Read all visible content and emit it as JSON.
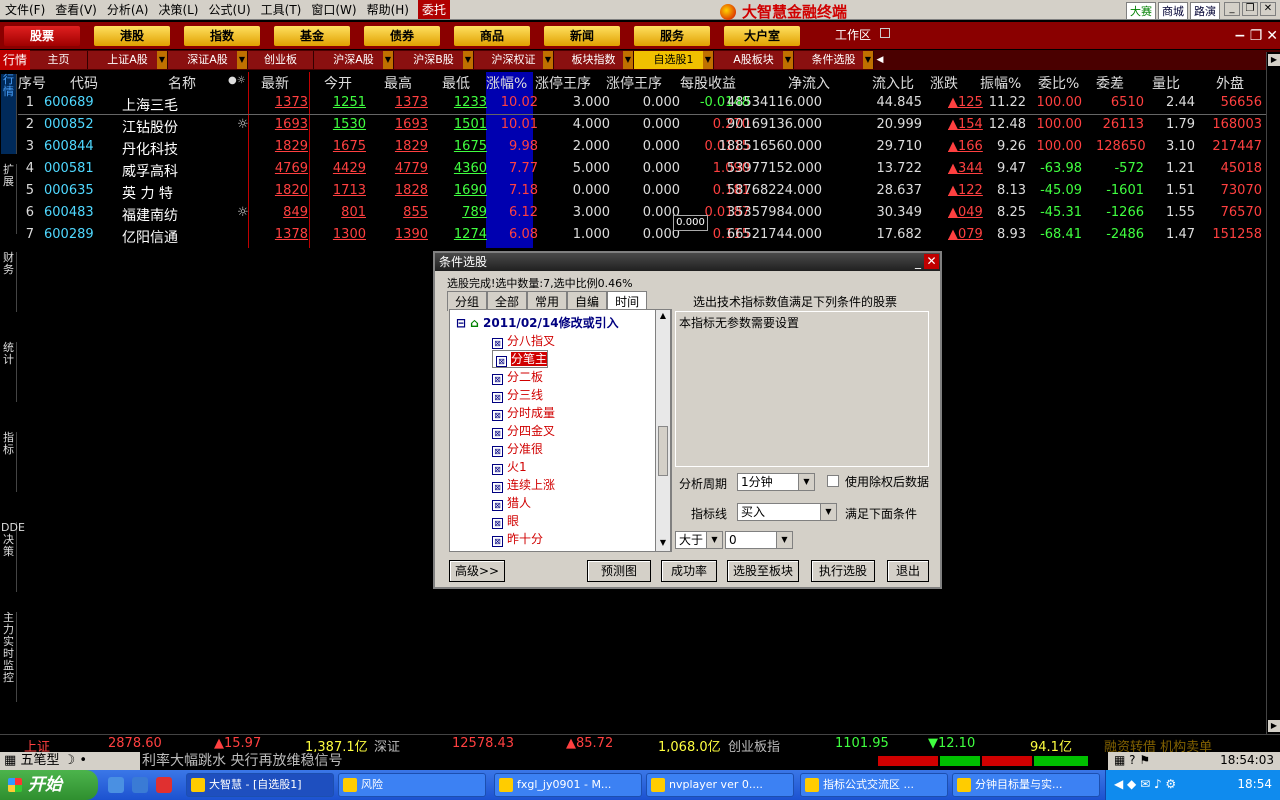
{
  "menu": [
    "文件(F)",
    "查看(V)",
    "分析(A)",
    "决策(L)",
    "公式(U)",
    "工具(T)",
    "窗口(W)",
    "帮助(H)"
  ],
  "weituo": "委托",
  "brand": "大智慧金融终端",
  "right_links": [
    "大赛",
    "商城",
    "路演"
  ],
  "categories": [
    "股票",
    "港股",
    "指数",
    "基金",
    "债券",
    "商品",
    "新闻",
    "服务",
    "大户室"
  ],
  "workzone": "工作区",
  "side_label": "行情",
  "tabs": [
    "主页",
    "上证A股",
    "深证A股",
    "创业板",
    "沪深A股",
    "沪深B股",
    "沪深权证",
    "板块指数",
    "自选股1",
    "A股板块",
    "条件选股"
  ],
  "left_tabs": [
    "行情",
    "扩展",
    "财务",
    "统计",
    "指标",
    "DDE决策",
    "主力实时监控"
  ],
  "columns": [
    "序号",
    "代码",
    "名称",
    "最新",
    "今开",
    "最高",
    "最低",
    "涨幅%",
    "涨停王序",
    "涨停王序",
    "每股收益",
    "净流入",
    "流入比",
    "涨跌",
    "振幅%",
    "委比%",
    "委差",
    "量比",
    "外盘"
  ],
  "rows": [
    {
      "seq": "1",
      "code": "600689",
      "name": "上海三毛",
      "flag": "",
      "last": "1373",
      "open": "1251",
      "high": "1373",
      "low": "1233",
      "chg": "10.02",
      "a": "3.000",
      "b": "0.000",
      "eps": "-0.0148",
      "inflow": "48534116.000",
      "ratio": "44.845",
      "up": "▲125",
      "amp": "11.22",
      "wb": "100.00",
      "wc": "6510",
      "lb": "2.44",
      "wp": "56656"
    },
    {
      "seq": "2",
      "code": "000852",
      "name": "江钻股份",
      "flag": "☼",
      "last": "1693",
      "open": "1530",
      "high": "1693",
      "low": "1501",
      "chg": "10.01",
      "a": "4.000",
      "b": "0.000",
      "eps": "0.270",
      "inflow": "90169136.000",
      "ratio": "20.999",
      "up": "▲154",
      "amp": "12.48",
      "wb": "100.00",
      "wc": "26113",
      "lb": "1.79",
      "wp": "168003"
    },
    {
      "seq": "3",
      "code": "600844",
      "name": "丹化科技",
      "flag": "",
      "last": "1829",
      "open": "1675",
      "high": "1829",
      "low": "1675",
      "chg": "9.98",
      "a": "2.000",
      "b": "0.000",
      "eps": "0.0115",
      "inflow": "188516560.000",
      "ratio": "29.710",
      "up": "▲166",
      "amp": "9.26",
      "wb": "100.00",
      "wc": "128650",
      "lb": "3.10",
      "wp": "217447"
    },
    {
      "seq": "4",
      "code": "000581",
      "name": "威孚高科",
      "flag": "",
      "last": "4769",
      "open": "4429",
      "high": "4779",
      "low": "4360",
      "chg": "7.77",
      "a": "5.000",
      "b": "0.000",
      "eps": "1.090",
      "inflow": "53977152.000",
      "ratio": "13.722",
      "up": "▲344",
      "amp": "9.47",
      "wb": "-63.98",
      "wc": "-572",
      "lb": "1.21",
      "wp": "45018"
    },
    {
      "seq": "5",
      "code": "000635",
      "name": "英 力 特",
      "flag": "",
      "last": "1820",
      "open": "1713",
      "high": "1828",
      "low": "1690",
      "chg": "7.18",
      "a": "0.000",
      "b": "0.000",
      "eps": "0.181",
      "inflow": "58768224.000",
      "ratio": "28.637",
      "up": "▲122",
      "amp": "8.13",
      "wb": "-45.09",
      "wc": "-1601",
      "lb": "1.51",
      "wp": "73070"
    },
    {
      "seq": "6",
      "code": "600483",
      "name": "福建南纺",
      "flag": "☼",
      "last": "849",
      "open": "801",
      "high": "855",
      "low": "789",
      "chg": "6.12",
      "a": "3.000",
      "b": "0.000",
      "eps": "0.0187",
      "inflow": "35357984.000",
      "ratio": "30.349",
      "up": "▲049",
      "amp": "8.25",
      "wb": "-45.31",
      "wc": "-1266",
      "lb": "1.55",
      "wp": "76570"
    },
    {
      "seq": "7",
      "code": "600289",
      "name": "亿阳信通",
      "flag": "",
      "last": "1378",
      "open": "1300",
      "high": "1390",
      "low": "1274",
      "chg": "6.08",
      "a": "1.000",
      "b": "0.000",
      "eps": "0.115",
      "inflow": "66521744.000",
      "ratio": "17.682",
      "up": "▲079",
      "amp": "8.93",
      "wb": "-68.41",
      "wc": "-2486",
      "lb": "1.47",
      "wp": "151258"
    }
  ],
  "tooltip": "0.000",
  "dialog": {
    "title": "条件选股",
    "status": "选股完成!选中数量:7,选中比例0.46%",
    "tabs": [
      "分组",
      "全部",
      "常用",
      "自编",
      "时间"
    ],
    "root": "2011/02/14修改或引入",
    "items": [
      "分八指叉",
      "分笔主",
      "分二板",
      "分三线",
      "分时成量",
      "分四金叉",
      "分准很",
      "火1",
      "连续上涨",
      "猎人",
      "眼",
      "昨十分"
    ],
    "selected_item": "分笔主",
    "hint": "选出技术指标数值满足下列条件的股票",
    "desc": "本指标无参数需要设置",
    "period_label": "分析周期",
    "period": "1分钟",
    "fq_label": "使用除权后数据",
    "line_label": "指标线",
    "line": "买入",
    "satisfy_label": "满足下面条件",
    "op": "大于",
    "value": "0",
    "buttons": [
      "高级>>",
      "预测图",
      "成功率",
      "选股至板块",
      "执行选股",
      "退出"
    ]
  },
  "index_bar": {
    "sh_name": "上证",
    "sh_val": "2878.60",
    "sh_chg": "▲15.97",
    "sh_amt": "1,387.1亿",
    "sz_name": "深证",
    "sz_val": "12578.43",
    "sz_chg": "▲85.72",
    "sz_amt": "1,068.0亿",
    "cy_name": "创业板指",
    "cy_val": "1101.95",
    "cy_chg": "▼12.10",
    "cy_amt": "94.1亿",
    "extra": "融资转借 机构卖单"
  },
  "ticker": {
    "tool": "五笔型",
    "msg": "利率大幅跳水 央行再放维稳信号",
    "clock": "18:54:03"
  },
  "taskbar": {
    "start": "开始",
    "tasks": [
      "大智慧 - [自选股1]",
      "风险",
      "fxgl_jy0901 - M...",
      "nvplayer ver 0....",
      "指标公式交流区 ...",
      "分钟目标量与实..."
    ],
    "clock": "18:54"
  }
}
